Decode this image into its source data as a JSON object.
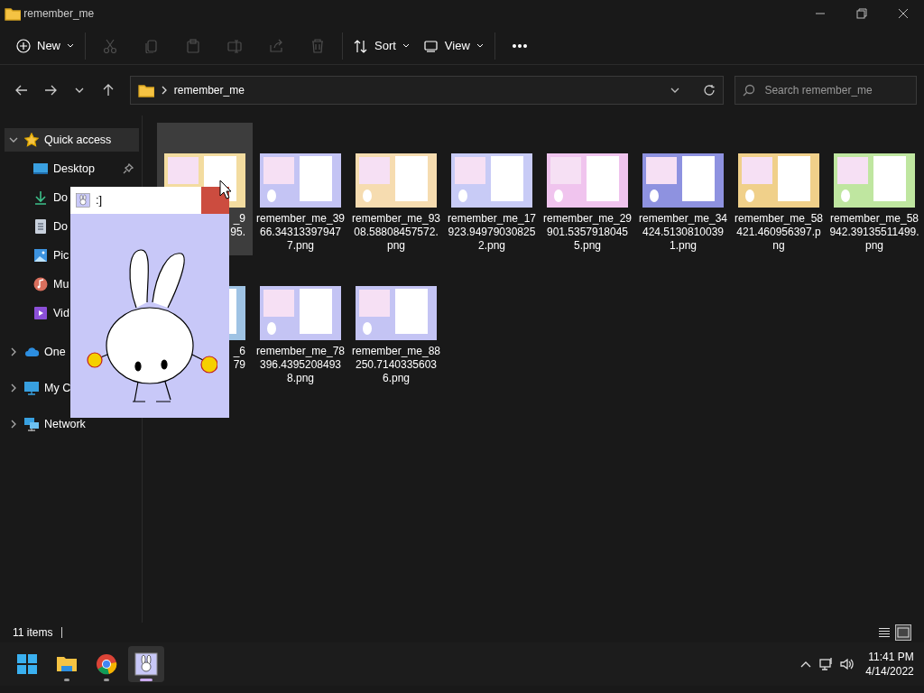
{
  "window": {
    "title": "remember_me"
  },
  "commands": [
    {
      "kind": "new",
      "label": "New",
      "disabled": false
    },
    {
      "kind": "cut",
      "disabled": true
    },
    {
      "kind": "copy",
      "disabled": true
    },
    {
      "kind": "paste",
      "disabled": true
    },
    {
      "kind": "rename",
      "disabled": true
    },
    {
      "kind": "share",
      "disabled": true
    },
    {
      "kind": "delete",
      "disabled": true
    },
    {
      "kind": "sort",
      "label": "Sort",
      "disabled": false
    },
    {
      "kind": "view",
      "label": "View",
      "disabled": false
    },
    {
      "kind": "more",
      "disabled": false
    }
  ],
  "address": {
    "path": "remember_me"
  },
  "search": {
    "placeholder": "Search remember_me"
  },
  "sidebar": {
    "items": [
      {
        "kind": "star",
        "label": "Quick access",
        "expanded": true,
        "selected": true,
        "children": [
          {
            "kind": "desktop",
            "label": "Desktop",
            "pinned": true,
            "selected": false
          },
          {
            "kind": "download",
            "label": "Do",
            "selected": false
          },
          {
            "kind": "document",
            "label": "Do",
            "selected": false
          },
          {
            "kind": "pictures",
            "label": "Pic",
            "selected": false
          },
          {
            "kind": "music",
            "label": "Mu",
            "selected": false
          },
          {
            "kind": "videos",
            "label": "Vid",
            "selected": false
          }
        ]
      },
      {
        "kind": "cloud",
        "label": "One",
        "expanded": false,
        "selected": false
      },
      {
        "kind": "monitor",
        "label": "My C",
        "expanded": false,
        "selected": false
      },
      {
        "kind": "network",
        "label": "Network",
        "expanded": false,
        "selected": false
      }
    ]
  },
  "files": [
    {
      "kind": "partial",
      "name_lines": [
        "_9",
        "95."
      ],
      "color": "#f3dca0",
      "selected": true
    },
    {
      "kind": "file",
      "name": "remember_me_3966.343133979477.png",
      "color": "#c4c4f4",
      "selected": false
    },
    {
      "kind": "file",
      "name": "remember_me_9308.58808457572.png",
      "color": "#f6dcb0",
      "selected": false
    },
    {
      "kind": "file",
      "name": "remember_me_17923.949790308252.png",
      "color": "#c8cbf6",
      "selected": false
    },
    {
      "kind": "file",
      "name": "remember_me_29901.53579180455.png",
      "color": "#f0c4ee",
      "selected": false
    },
    {
      "kind": "file",
      "name": "remember_me_34424.51308100391.png",
      "color": "#8e92e0",
      "selected": false
    },
    {
      "kind": "file",
      "name": "remember_me_58421.460956397.png",
      "color": "#f0d08a",
      "selected": false
    },
    {
      "kind": "file",
      "name": "remember_me_58942.39135511499.png",
      "color": "#bfe6a0",
      "selected": false
    },
    {
      "kind": "partial",
      "name_lines": [
        "_6",
        "79"
      ],
      "color": "#9fc3e4",
      "selected": false
    },
    {
      "kind": "file",
      "name": "remember_me_78396.43952084938.png",
      "color": "#c4c4f4",
      "selected": false
    },
    {
      "kind": "file",
      "name": "remember_me_88250.71403356036.png",
      "color": "#c4c4f4",
      "selected": false
    }
  ],
  "status_bar": {
    "count": "11 items",
    "view_modes": [
      {
        "kind": "details",
        "selected": false
      },
      {
        "kind": "thumbnails",
        "selected": true
      }
    ]
  },
  "popup": {
    "title": ":]"
  },
  "taskbar": {
    "apps": [
      {
        "kind": "start",
        "active": false,
        "running": false
      },
      {
        "kind": "explorer",
        "active": false,
        "running": true
      },
      {
        "kind": "browser",
        "active": false,
        "running": true
      },
      {
        "kind": "bunny",
        "active": true,
        "running": true
      }
    ],
    "time": "11:41 PM",
    "date": "4/14/2022"
  }
}
